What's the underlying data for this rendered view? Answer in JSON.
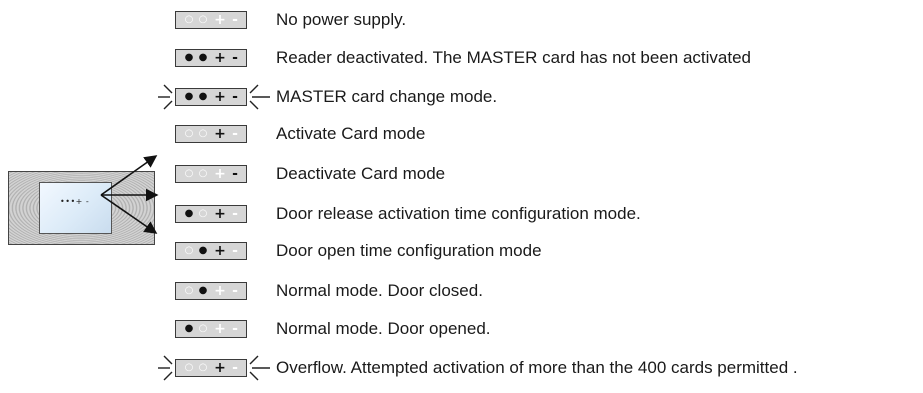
{
  "led_states": [
    {
      "leds": [
        "off",
        "off",
        "off",
        "off"
      ],
      "blinking": false,
      "label": "No power supply."
    },
    {
      "leds": [
        "on",
        "on",
        "on",
        "on"
      ],
      "blinking": false,
      "label": "Reader deactivated. The MASTER card has not been activated"
    },
    {
      "leds": [
        "on",
        "on",
        "on",
        "on"
      ],
      "blinking": true,
      "label": "MASTER card change mode."
    },
    {
      "leds": [
        "off",
        "off",
        "on",
        "off"
      ],
      "blinking": false,
      "label": "Activate Card mode"
    },
    {
      "leds": [
        "off",
        "off",
        "off",
        "on"
      ],
      "blinking": false,
      "label": "Deactivate Card mode"
    },
    {
      "leds": [
        "on",
        "off",
        "on",
        "off"
      ],
      "blinking": false,
      "label": "Door release activation time configuration mode."
    },
    {
      "leds": [
        "off",
        "on",
        "on",
        "off"
      ],
      "blinking": false,
      "label": "Door open time configuration mode"
    },
    {
      "leds": [
        "off",
        "on",
        "off",
        "off"
      ],
      "blinking": false,
      "label": "Normal mode. Door closed."
    },
    {
      "leds": [
        "on",
        "off",
        "off",
        "off"
      ],
      "blinking": false,
      "label": "Normal mode. Door opened."
    },
    {
      "leds": [
        "off",
        "off",
        "on",
        "off"
      ],
      "blinking": true,
      "label": "Overflow. Attempted activation of more than the 400 cards permitted ."
    }
  ],
  "device": {
    "led_symbols": "•••+ -"
  },
  "colors": {
    "indicator_fill": "#d6d6d6",
    "led_on": "#111111",
    "led_off": "#ffffff",
    "screen": "#dcebf8"
  }
}
